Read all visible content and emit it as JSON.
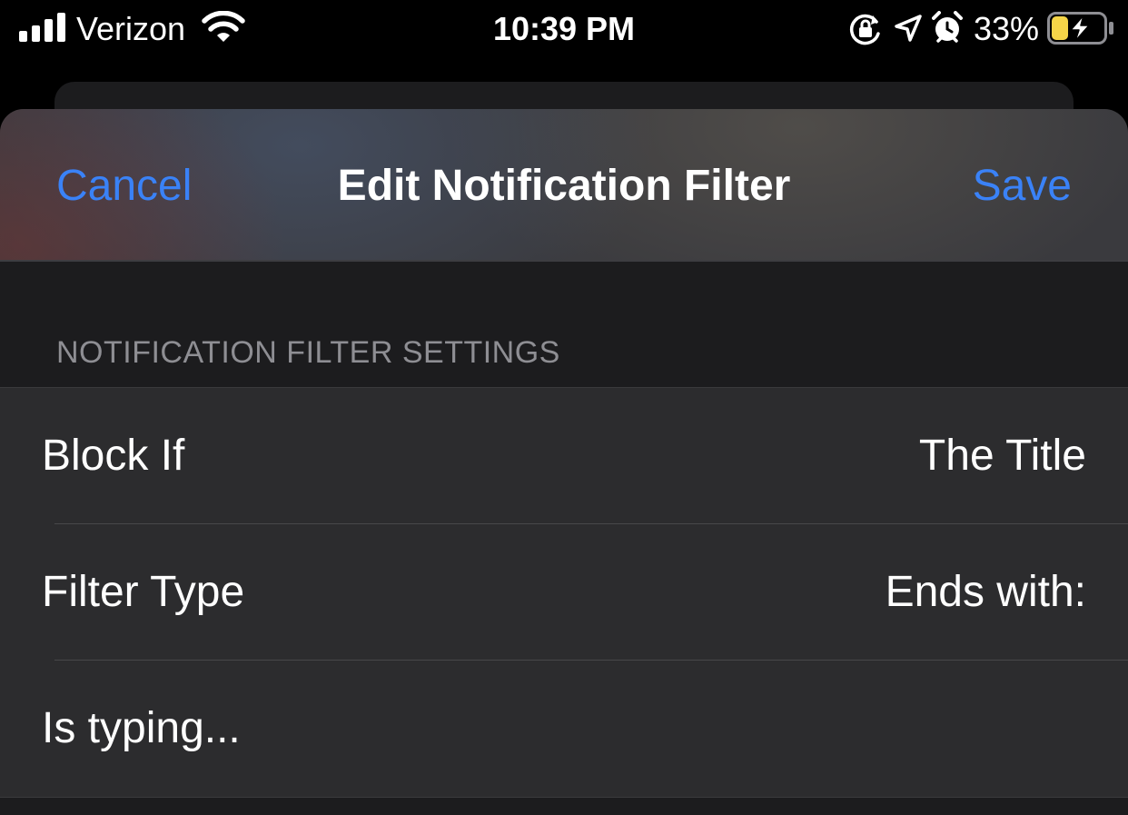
{
  "status_bar": {
    "carrier": "Verizon",
    "time": "10:39 PM",
    "battery_percent": "33%",
    "icons": [
      "signal-icon",
      "wifi-icon",
      "rotation-lock-icon",
      "location-arrow-icon",
      "alarm-icon",
      "battery-charging-icon"
    ],
    "battery_level": 0.33,
    "battery_fill_color": "#f5d548"
  },
  "nav": {
    "cancel_label": "Cancel",
    "title": "Edit Notification Filter",
    "save_label": "Save",
    "accent_color": "#3a82f7"
  },
  "section": {
    "header": "NOTIFICATION FILTER SETTINGS"
  },
  "rows": [
    {
      "label": "Block If",
      "value": "The Title"
    },
    {
      "label": "Filter Type",
      "value": "Ends with:"
    },
    {
      "input_value": "Is typing..."
    }
  ]
}
